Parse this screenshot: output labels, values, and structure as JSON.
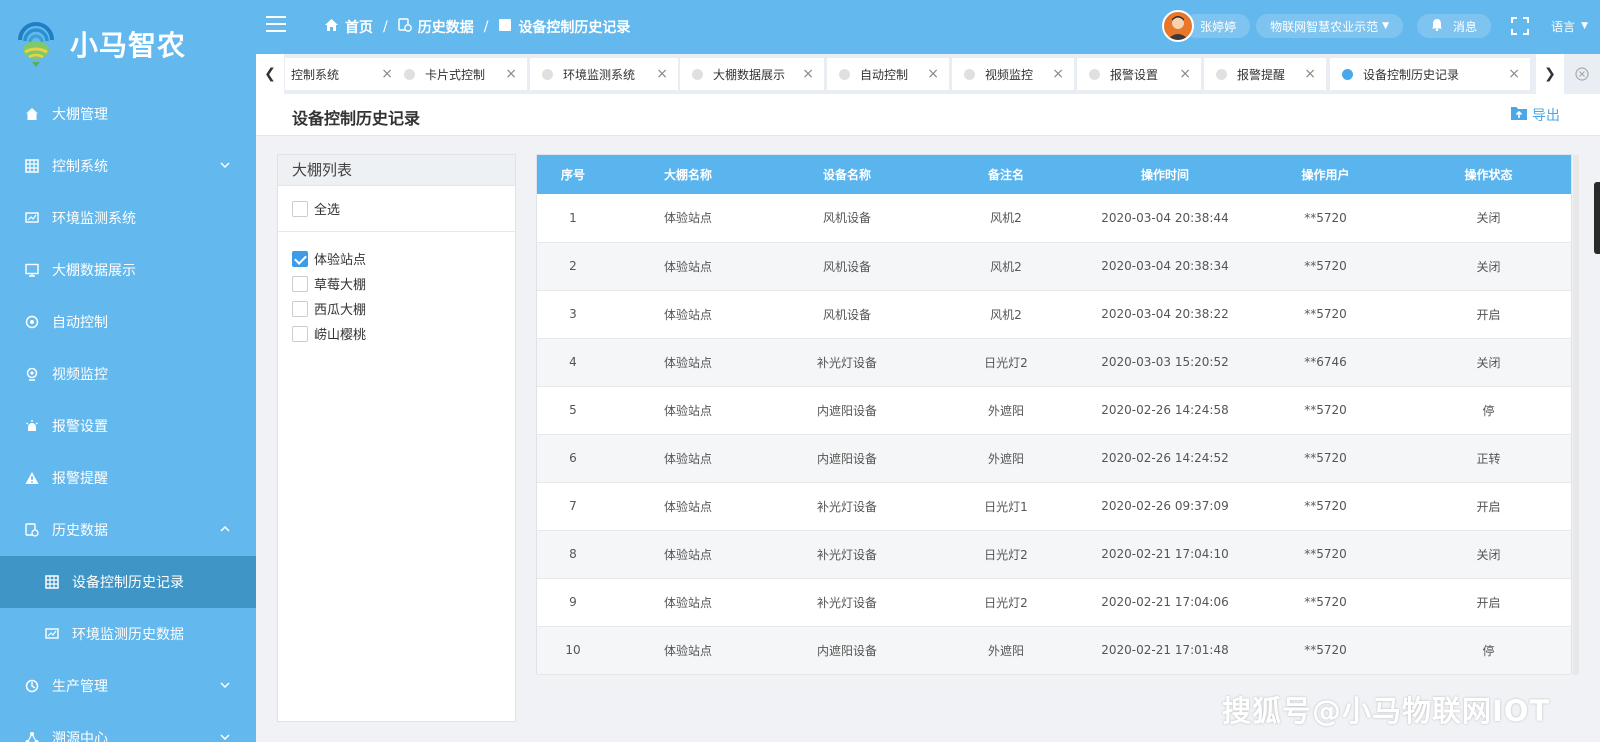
{
  "brand": {
    "title": "小马智农"
  },
  "sidebar": {
    "items": [
      {
        "label": "大棚管理",
        "icon": "home-icon"
      },
      {
        "label": "控制系统",
        "icon": "grid-icon",
        "arrow": "down"
      },
      {
        "label": "环境监测系统",
        "icon": "monitor-chart-icon"
      },
      {
        "label": "大棚数据展示",
        "icon": "display-icon"
      },
      {
        "label": "自动控制",
        "icon": "auto-icon"
      },
      {
        "label": "视频监控",
        "icon": "camera-icon"
      },
      {
        "label": "报警设置",
        "icon": "alarm-icon"
      },
      {
        "label": "报警提醒",
        "icon": "warning-icon"
      },
      {
        "label": "历史数据",
        "icon": "history-icon",
        "arrow": "up"
      },
      {
        "label": "设备控制历史记录",
        "icon": "table-icon",
        "sub": true,
        "active": true
      },
      {
        "label": "环境监测历史数据",
        "icon": "chart-icon",
        "sub": true
      },
      {
        "label": "生产管理",
        "icon": "production-icon",
        "arrow": "down"
      },
      {
        "label": "溯源中心",
        "icon": "trace-icon",
        "arrow": "down"
      }
    ]
  },
  "header": {
    "breadcrumb": [
      "首页",
      "历史数据",
      "设备控制历史记录"
    ],
    "user_name": "张婷婷",
    "org_name": "物联网智慧农业示范",
    "messages_label": "消息",
    "language_label": "语言"
  },
  "tabs": [
    {
      "label": "控制系统"
    },
    {
      "label": "卡片式控制"
    },
    {
      "label": "环境监测系统"
    },
    {
      "label": "大棚数据展示"
    },
    {
      "label": "自动控制"
    },
    {
      "label": "视频监控"
    },
    {
      "label": "报警设置"
    },
    {
      "label": "报警提醒"
    },
    {
      "label": "设备控制历史记录",
      "active": true
    }
  ],
  "page": {
    "title": "设备控制历史记录",
    "export_label": "导出"
  },
  "greenhouse_panel": {
    "title": "大棚列表",
    "select_all": "全选",
    "items": [
      {
        "label": "体验站点",
        "checked": true
      },
      {
        "label": "草莓大棚",
        "checked": false
      },
      {
        "label": "西瓜大棚",
        "checked": false
      },
      {
        "label": "崂山樱桃",
        "checked": false
      }
    ]
  },
  "table": {
    "columns": [
      "序号",
      "大棚名称",
      "设备名称",
      "备注名",
      "操作时间",
      "操作用户",
      "操作状态"
    ],
    "rows": [
      [
        "1",
        "体验站点",
        "风机设备",
        "风机2",
        "2020-03-04 20:38:44",
        "**5720",
        "关闭"
      ],
      [
        "2",
        "体验站点",
        "风机设备",
        "风机2",
        "2020-03-04 20:38:34",
        "**5720",
        "关闭"
      ],
      [
        "3",
        "体验站点",
        "风机设备",
        "风机2",
        "2020-03-04 20:38:22",
        "**5720",
        "开启"
      ],
      [
        "4",
        "体验站点",
        "补光灯设备",
        "日光灯2",
        "2020-03-03 15:20:52",
        "**6746",
        "关闭"
      ],
      [
        "5",
        "体验站点",
        "内遮阳设备",
        "外遮阳",
        "2020-02-26 14:24:58",
        "**5720",
        "停"
      ],
      [
        "6",
        "体验站点",
        "内遮阳设备",
        "外遮阳",
        "2020-02-26 14:24:52",
        "**5720",
        "正转"
      ],
      [
        "7",
        "体验站点",
        "补光灯设备",
        "日光灯1",
        "2020-02-26 09:37:09",
        "**5720",
        "开启"
      ],
      [
        "8",
        "体验站点",
        "补光灯设备",
        "日光灯2",
        "2020-02-21 17:04:10",
        "**5720",
        "关闭"
      ],
      [
        "9",
        "体验站点",
        "补光灯设备",
        "日光灯2",
        "2020-02-21 17:04:06",
        "**5720",
        "开启"
      ],
      [
        "10",
        "体验站点",
        "内遮阳设备",
        "外遮阳",
        "2020-02-21 17:01:48",
        "**5720",
        "停"
      ]
    ]
  },
  "watermark": "搜狐号@小马物联网IOT"
}
